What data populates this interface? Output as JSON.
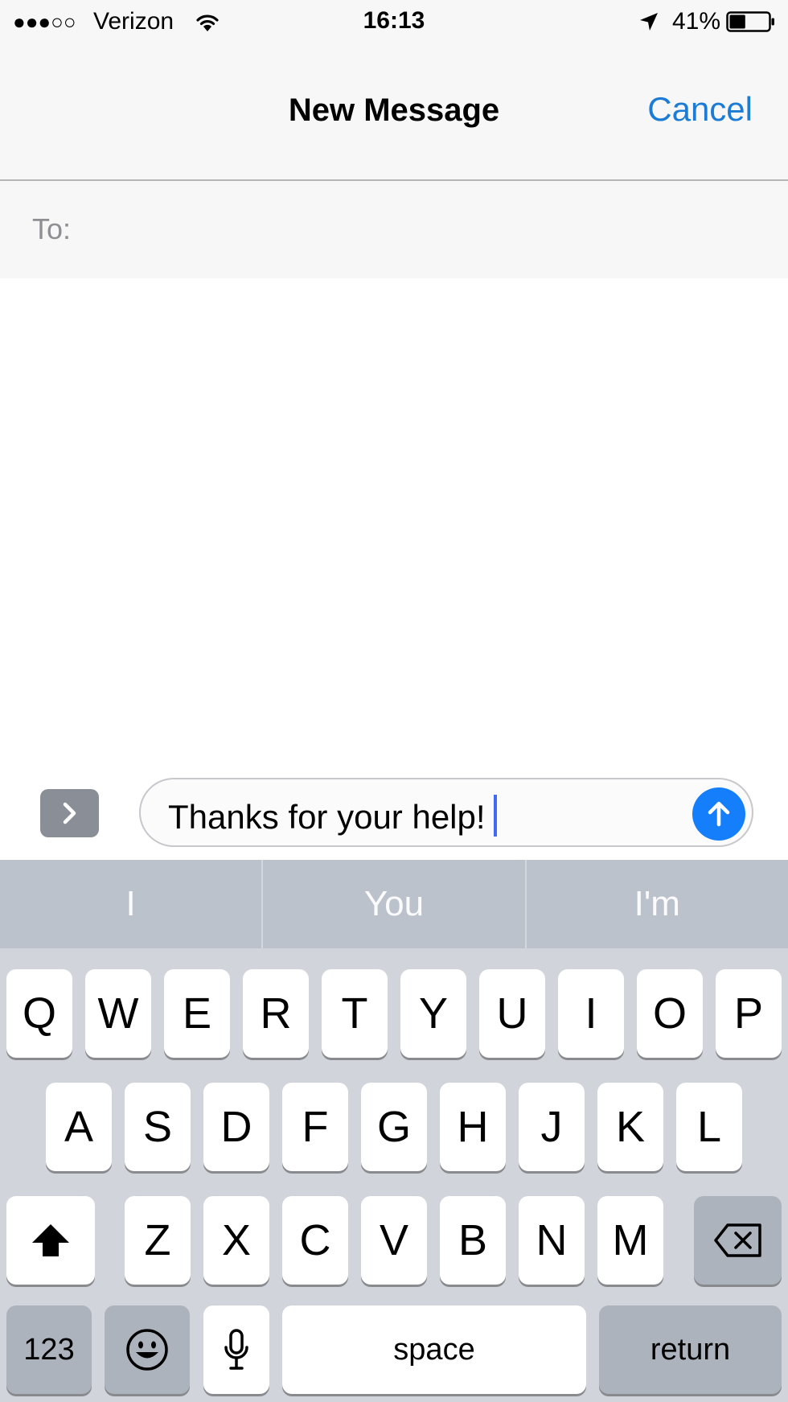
{
  "status_bar": {
    "signal": "●●●○○",
    "carrier": "Verizon",
    "time": "16:13",
    "battery_percent": "41%",
    "battery_level": 0.41,
    "icons": [
      "wifi-icon",
      "location-arrow-icon",
      "battery-icon"
    ]
  },
  "nav": {
    "title": "New Message",
    "cancel_label": "Cancel"
  },
  "recipient": {
    "label": "To:",
    "value": ""
  },
  "compose": {
    "text": "Thanks for your help!",
    "icons": [
      "chevron-right-icon",
      "send-arrow-up-icon"
    ]
  },
  "suggestions": [
    "I",
    "You",
    "I'm"
  ],
  "keyboard": {
    "row1": [
      "Q",
      "W",
      "E",
      "R",
      "T",
      "Y",
      "U",
      "I",
      "O",
      "P"
    ],
    "row2": [
      "A",
      "S",
      "D",
      "F",
      "G",
      "H",
      "J",
      "K",
      "L"
    ],
    "row3": [
      "Z",
      "X",
      "C",
      "V",
      "B",
      "N",
      "M"
    ],
    "numbers_label": "123",
    "space_label": "space",
    "return_label": "return",
    "icons": [
      "shift-icon",
      "delete-icon",
      "emoji-icon",
      "microphone-icon"
    ]
  },
  "colors": {
    "accent": "#1c7cd5",
    "send": "#157efb",
    "keyboard_bg": "#d1d5db",
    "predictive_bg": "#bcc2cb"
  }
}
